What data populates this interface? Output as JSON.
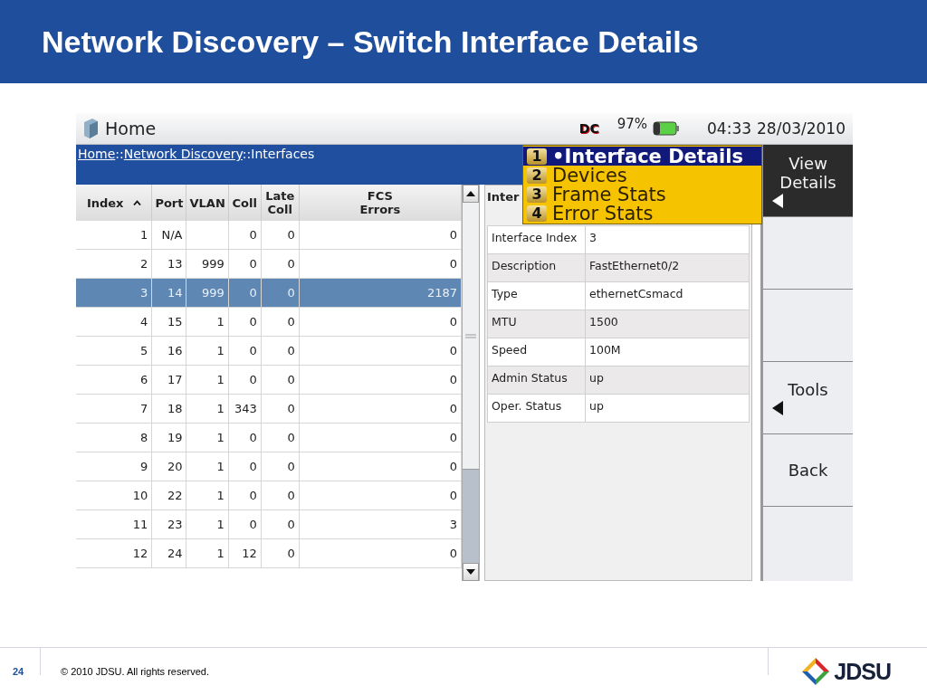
{
  "slide": {
    "title": "Network Discovery – Switch Interface Details"
  },
  "status_bar": {
    "title": "Home",
    "network_badge": "DC",
    "battery": "97%",
    "time": "04:33",
    "date": "28/03/2010"
  },
  "breadcrumb": [
    {
      "label": "Home",
      "link": true
    },
    {
      "label": "::",
      "link": false
    },
    {
      "label": "Network Discovery",
      "link": true
    },
    {
      "label": "::Interfaces",
      "link": false
    }
  ],
  "table": {
    "columns": [
      {
        "label": "Index",
        "sorted": true
      },
      {
        "label": "Port",
        "sorted": false
      },
      {
        "label": "VLAN",
        "sorted": false
      },
      {
        "label": "Coll",
        "sorted": false
      },
      {
        "label": "Late Coll",
        "sorted": false
      },
      {
        "label": "FCS Errors",
        "sorted": false
      }
    ],
    "rows": [
      {
        "selected": false,
        "cells": [
          "1",
          "N/A",
          null,
          "0",
          "0",
          "0"
        ]
      },
      {
        "selected": false,
        "cells": [
          "2",
          "13",
          "999",
          "0",
          "0",
          "0"
        ]
      },
      {
        "selected": true,
        "cells": [
          "3",
          "14",
          "999",
          "0",
          "0",
          "2187"
        ]
      },
      {
        "selected": false,
        "cells": [
          "4",
          "15",
          "1",
          "0",
          "0",
          "0"
        ]
      },
      {
        "selected": false,
        "cells": [
          "5",
          "16",
          "1",
          "0",
          "0",
          "0"
        ]
      },
      {
        "selected": false,
        "cells": [
          "6",
          "17",
          "1",
          "0",
          "0",
          "0"
        ]
      },
      {
        "selected": false,
        "cells": [
          "7",
          "18",
          "1",
          "343",
          "0",
          "0"
        ]
      },
      {
        "selected": false,
        "cells": [
          "8",
          "19",
          "1",
          "0",
          "0",
          "0"
        ]
      },
      {
        "selected": false,
        "cells": [
          "9",
          "20",
          "1",
          "0",
          "0",
          "0"
        ]
      },
      {
        "selected": false,
        "cells": [
          "10",
          "22",
          "1",
          "0",
          "0",
          "0"
        ]
      },
      {
        "selected": false,
        "cells": [
          "11",
          "23",
          "1",
          "0",
          "0",
          "3"
        ]
      },
      {
        "selected": false,
        "cells": [
          "12",
          "24",
          "1",
          "12",
          "0",
          "0"
        ]
      }
    ]
  },
  "details_panel": {
    "title": "Inter",
    "rows": [
      {
        "label": "Interface Index",
        "value": "3"
      },
      {
        "label": "Description",
        "value": "FastEthernet0/2"
      },
      {
        "label": "Type",
        "value": "ethernetCsmacd"
      },
      {
        "label": "MTU",
        "value": "1500"
      },
      {
        "label": "Speed",
        "value": "100M"
      },
      {
        "label": "Admin Status",
        "value": "up"
      },
      {
        "label": "Oper. Status",
        "value": "up"
      }
    ]
  },
  "menu": {
    "selected_marker": "•",
    "items": [
      {
        "key": "1",
        "label": "Interface Details",
        "selected": true
      },
      {
        "key": "2",
        "label": "Devices",
        "selected": false
      },
      {
        "key": "3",
        "label": "Frame Stats",
        "selected": false
      },
      {
        "key": "4",
        "label": "Error Stats",
        "selected": false
      }
    ]
  },
  "softkeys": [
    {
      "kind": "key",
      "label": "View Details",
      "selected": true,
      "submenu": true
    },
    {
      "kind": "blank"
    },
    {
      "kind": "blank"
    },
    {
      "kind": "key",
      "label": "Tools",
      "selected": false,
      "submenu": true
    },
    {
      "kind": "key",
      "label": "Back",
      "selected": false,
      "submenu": false
    },
    {
      "kind": "blank"
    }
  ],
  "footer": {
    "page": "24",
    "copyright": "© 2010 JDSU. All rights reserved.",
    "logo": "JDSU"
  }
}
